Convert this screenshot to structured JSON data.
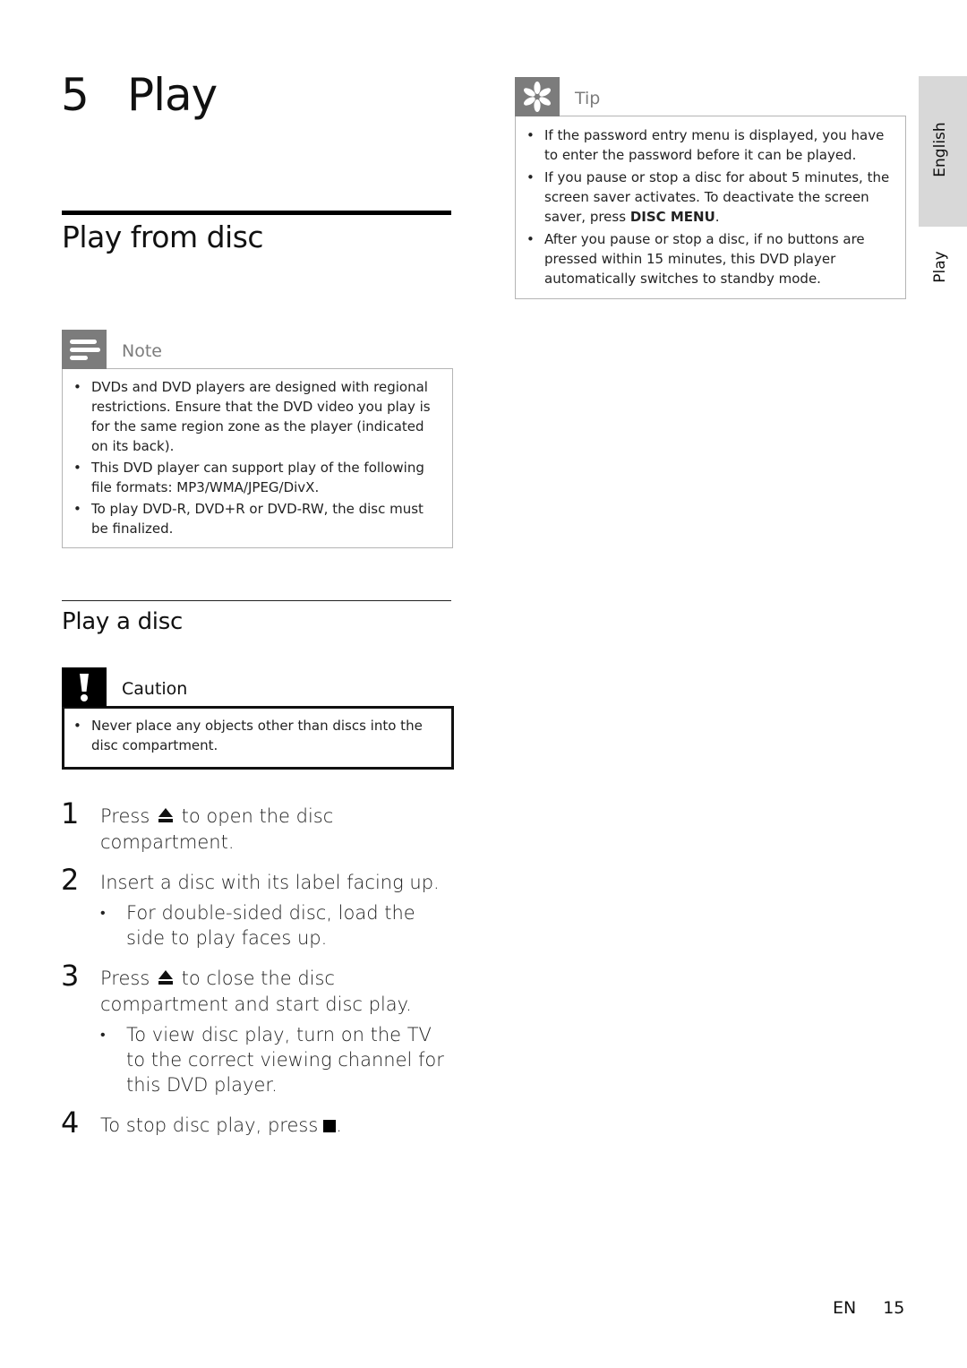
{
  "chapter": {
    "number": "5",
    "title": "Play"
  },
  "section": {
    "title": "Play from disc"
  },
  "note": {
    "title": "Note",
    "icon": "note-lines-icon",
    "items": [
      "DVDs and DVD players are designed with regional restrictions. Ensure that the DVD video you play is for the same region zone as the player (indicated on its back).",
      "This DVD player can support play of the following file formats: MP3/WMA/JPEG/DivX.",
      "To play DVD-R, DVD+R or DVD-RW, the disc must be finalized."
    ]
  },
  "subsection": {
    "title": "Play a disc"
  },
  "caution": {
    "title": "Caution",
    "icon": "exclamation-icon",
    "items": [
      "Never place any objects other than discs into the disc compartment."
    ]
  },
  "steps": [
    {
      "num": "1",
      "pre": "Press",
      "icon": "eject-icon",
      "post": "to open the disc compartment."
    },
    {
      "num": "2",
      "text": "Insert a disc with its label facing up.",
      "sub": "For double-sided disc, load the side to play faces up."
    },
    {
      "num": "3",
      "pre": "Press",
      "icon": "eject-icon",
      "post": "to close the disc compartment and start disc play.",
      "sub": "To view disc play, turn on the TV to the correct viewing channel for this DVD player."
    },
    {
      "num": "4",
      "pre": "To stop disc play, press",
      "icon": "stop-icon",
      "post": "."
    }
  ],
  "tip": {
    "title": "Tip",
    "icon": "asterisk-icon",
    "items": [
      {
        "text": "If the password entry menu is displayed, you have to enter the password before it can be played."
      },
      {
        "pre": "If you pause or stop a disc for about 5 minutes, the screen saver activates. To deactivate the screen saver, press ",
        "bold": "DISC MENU",
        "post": "."
      },
      {
        "text": "After you pause or stop a disc, if no buttons are pressed within 15 minutes, this DVD player automatically switches to standby mode."
      }
    ]
  },
  "side_tabs": {
    "language": "English",
    "chapter": "Play"
  },
  "footer": {
    "lang": "EN",
    "page": "15"
  }
}
